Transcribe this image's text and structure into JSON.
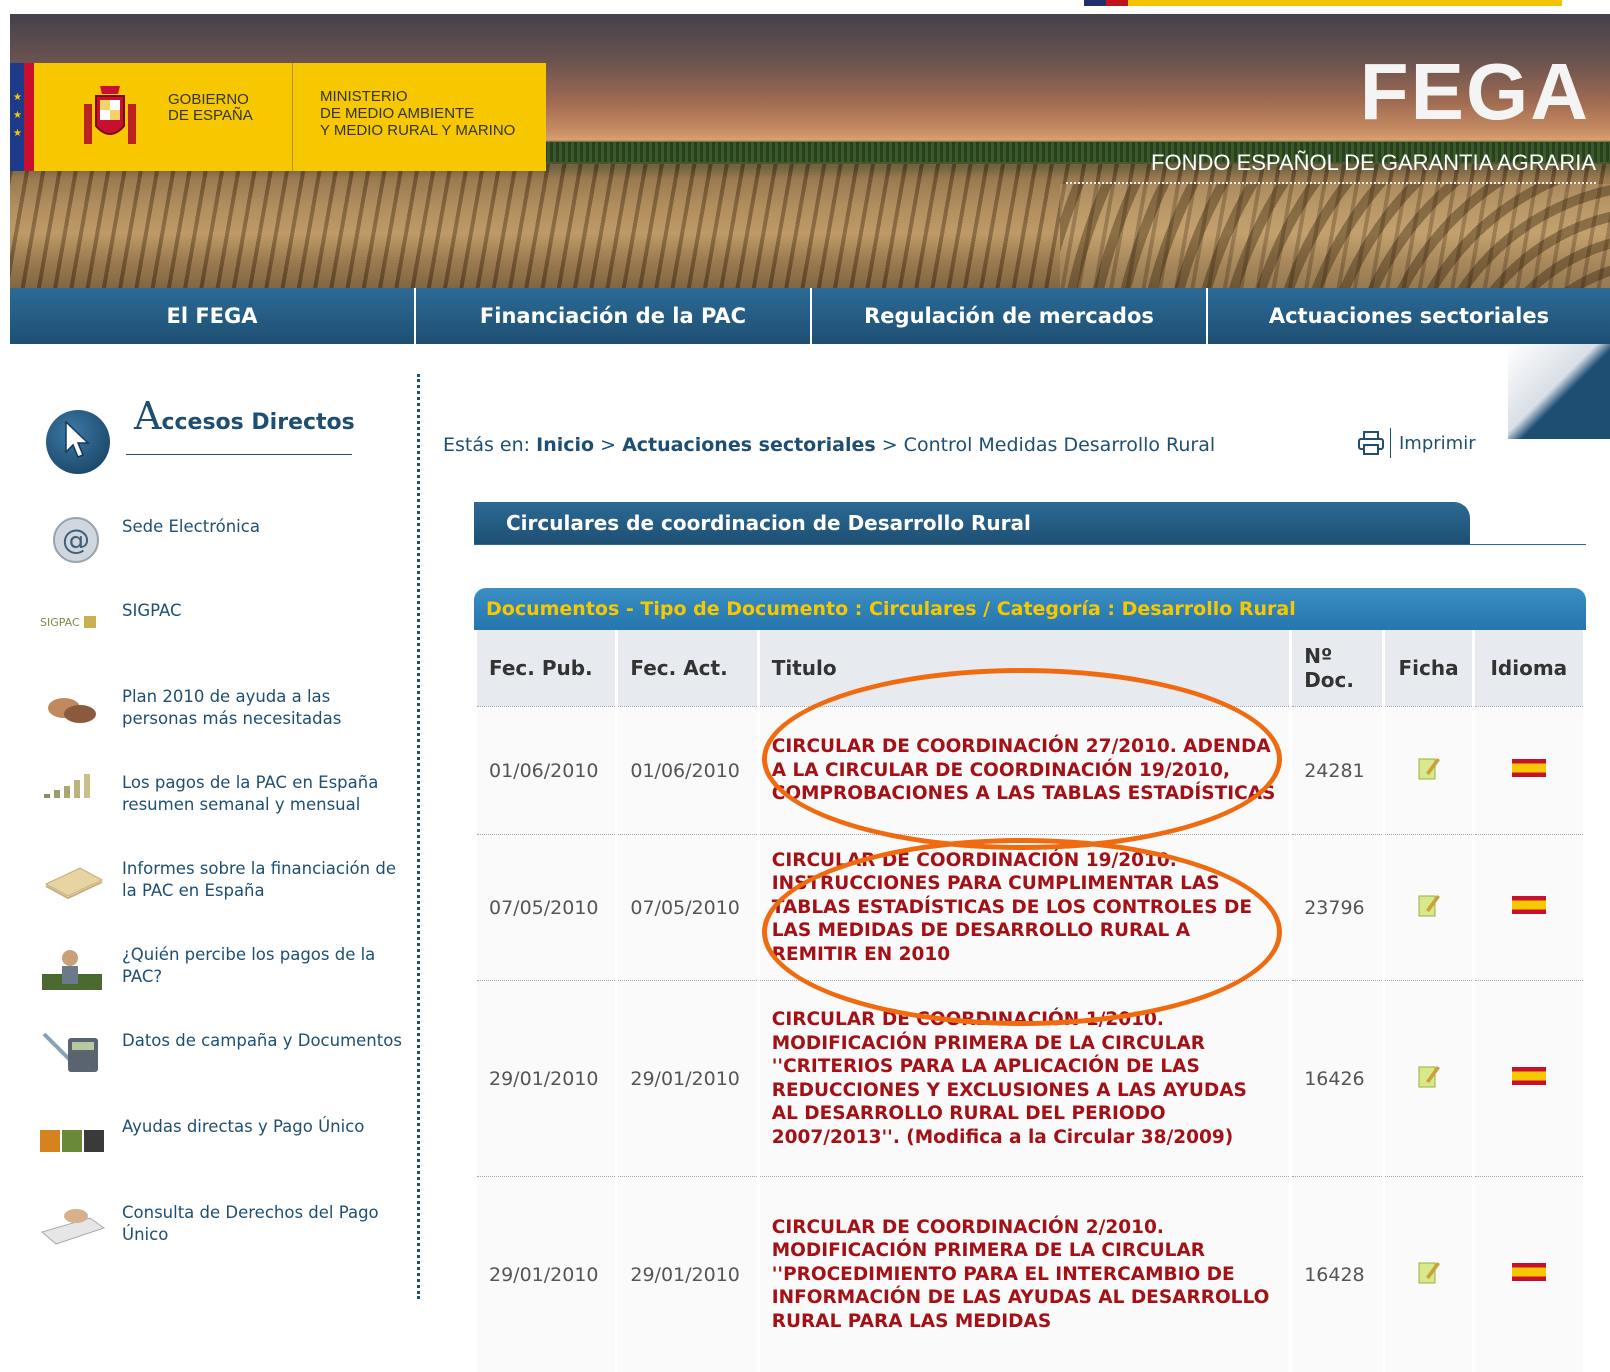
{
  "header": {
    "gov_line1": "GOBIERNO",
    "gov_line2": "DE ESPAÑA",
    "ministry_line1": "MINISTERIO",
    "ministry_line2": "DE MEDIO AMBIENTE",
    "ministry_line3": "Y MEDIO RURAL Y MARINO",
    "logo": "FEGA",
    "subtitle": "FONDO ESPAÑOL DE GARANTIA AGRARIA"
  },
  "nav": [
    {
      "label": "El FEGA"
    },
    {
      "label": "Financiación de la PAC"
    },
    {
      "label": "Regulación de mercados"
    },
    {
      "label": "Actuaciones sectoriales"
    }
  ],
  "sidebar": {
    "title_initial": "A",
    "title_rest": "ccesos Directos",
    "items": [
      {
        "label": "Sede Electrónica",
        "icon": "at-sign-icon"
      },
      {
        "label": "SIGPAC",
        "icon": "sigpac-logo-icon",
        "icon_text": "SIGPAC"
      },
      {
        "label": "Plan 2010 de ayuda a las personas más necesitadas",
        "icon": "hands-icon"
      },
      {
        "label": "Los pagos de la PAC en España resumen semanal y mensual",
        "icon": "bar-chart-icon"
      },
      {
        "label": "Informes sobre la financiación de la PAC en España",
        "icon": "documents-icon"
      },
      {
        "label": "¿Quién percibe los pagos de la PAC?",
        "icon": "farmer-icon"
      },
      {
        "label": "Datos de campaña y Documentos",
        "icon": "calculator-icon"
      },
      {
        "label": "Ayudas directas y Pago Único",
        "icon": "crops-icon"
      },
      {
        "label": "Consulta de Derechos del Pago Único",
        "icon": "keyboard-icon"
      }
    ]
  },
  "breadcrumb": {
    "prefix": "Estás en:",
    "home": "Inicio",
    "sep": ">",
    "section": "Actuaciones sectoriales",
    "current": "Control Medidas Desarrollo Rural"
  },
  "print_label": "Imprimir",
  "section_title": "Circulares de coordinacion de Desarrollo Rural",
  "docs": {
    "heading": "Documentos - Tipo de Documento : Circulares / Categoría : Desarrollo Rural",
    "columns": {
      "pub": "Fec. Pub.",
      "act": "Fec. Act.",
      "title": "Titulo",
      "num_line1": "Nº",
      "num_line2": "Doc.",
      "ficha": "Ficha",
      "idioma": "Idioma"
    },
    "rows": [
      {
        "pub": "01/06/2010",
        "act": "01/06/2010",
        "title": "CIRCULAR DE COORDINACIÓN 27/2010. ADENDA A LA CIRCULAR DE COORDINACIÓN 19/2010, COMPROBACIONES A LAS TABLAS ESTADÍSTICAS",
        "num": "24281"
      },
      {
        "pub": "07/05/2010",
        "act": "07/05/2010",
        "title": "CIRCULAR DE COORDINACIÓN 19/2010. INSTRUCCIONES PARA CUMPLIMENTAR LAS TABLAS ESTADÍSTICAS DE LOS CONTROLES DE LAS MEDIDAS DE DESARROLLO RURAL A REMITIR EN 2010",
        "num": "23796"
      },
      {
        "pub": "29/01/2010",
        "act": "29/01/2010",
        "title": "CIRCULAR DE COORDINACIÓN 1/2010. MODIFICACIÓN PRIMERA DE LA CIRCULAR ''CRITERIOS PARA LA APLICACIÓN DE LAS REDUCCIONES Y EXCLUSIONES A LAS AYUDAS AL DESARROLLO RURAL DEL PERIODO 2007/2013''. (Modifica a la Circular 38/2009)",
        "num": "16426"
      },
      {
        "pub": "29/01/2010",
        "act": "29/01/2010",
        "title": "CIRCULAR DE COORDINACIÓN 2/2010. MODIFICACIÓN PRIMERA DE LA CIRCULAR ''PROCEDIMIENTO PARA EL INTERCAMBIO DE INFORMACIÓN DE LAS AYUDAS AL DESARROLLO RURAL PARA LAS MEDIDAS",
        "num": "16428"
      }
    ]
  },
  "colors": {
    "nav_blue": "#1e4f73",
    "title_red": "#a31116",
    "gov_yellow": "#f7c800",
    "annotation_orange": "#f06a10"
  }
}
